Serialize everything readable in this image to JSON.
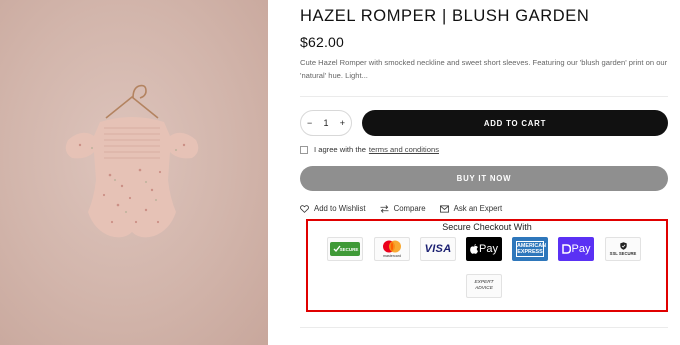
{
  "product": {
    "title": "HAZEL ROMPER | BLUSH GARDEN",
    "price": "$62.00",
    "description": "Cute Hazel Romper with smocked neckline and sweet short sleeves. Featuring our 'blush garden' print on our 'natural' hue. Light..."
  },
  "quantity": {
    "minus": "−",
    "value": "1",
    "plus": "+"
  },
  "buttons": {
    "add_to_cart": "ADD TO CART",
    "buy_now": "BUY IT NOW"
  },
  "terms": {
    "text": "I agree with the",
    "link": "terms and conditions",
    "checked": false
  },
  "actions": [
    {
      "label": "Add to Wishlist",
      "icon": "heart-icon"
    },
    {
      "label": "Compare",
      "icon": "compare-arrows-icon"
    },
    {
      "label": "Ask an Expert",
      "icon": "envelope-icon"
    }
  ],
  "secure_checkout": {
    "title": "Secure Checkout With",
    "badges": [
      {
        "name": "secure-badge",
        "label": "SECURE"
      },
      {
        "name": "mastercard-badge",
        "label": "mastercard"
      },
      {
        "name": "visa-badge",
        "label": "VISA"
      },
      {
        "name": "apple-pay-badge",
        "label": "Pay"
      },
      {
        "name": "american-express-badge",
        "label": "AMERICAN EXPRESS"
      },
      {
        "name": "opay-badge",
        "label": "Pay"
      },
      {
        "name": "ssl-secure-badge",
        "label": "SSL SECURE"
      },
      {
        "name": "expert-advice-badge",
        "label": "EXPERT ADVICE"
      }
    ]
  },
  "colors": {
    "accent_dark": "#111111",
    "buy_now_gray": "#8f8f8f",
    "highlight_red": "#e00000",
    "photo_bg": "#d2b5ab"
  }
}
